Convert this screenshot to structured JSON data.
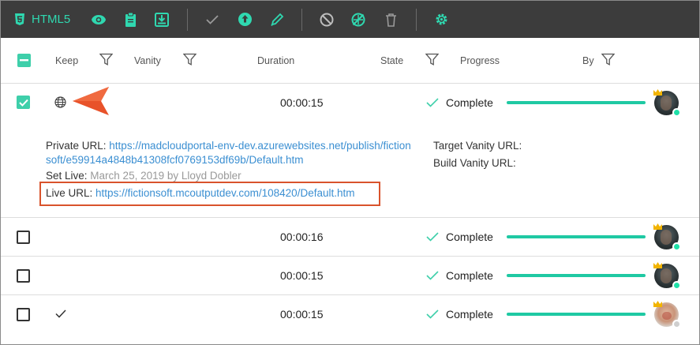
{
  "toolbar": {
    "html5_label": "HTML5",
    "brand_color": "#2fd8b0"
  },
  "header": {
    "keep": "Keep",
    "vanity": "Vanity",
    "duration": "Duration",
    "state": "State",
    "progress": "Progress",
    "by": "By"
  },
  "rows": [
    {
      "selected": true,
      "keep_icon": "globe-icon",
      "duration": "00:00:15",
      "status": "Complete",
      "progress": 1.0,
      "presence": "online"
    },
    {
      "selected": false,
      "keep_icon": "",
      "duration": "00:00:16",
      "status": "Complete",
      "progress": 1.0,
      "presence": "online"
    },
    {
      "selected": false,
      "keep_icon": "",
      "duration": "00:00:15",
      "status": "Complete",
      "progress": 1.0,
      "presence": "online"
    },
    {
      "selected": false,
      "keep_icon": "check-icon",
      "duration": "00:00:15",
      "status": "Complete",
      "progress": 1.0,
      "presence": "offline"
    }
  ],
  "details": {
    "private_url_label": "Private URL:",
    "private_url_line1": "https://madcloudportal-env-dev.azurewebsites.net/publish/fiction",
    "private_url_line2": "soft/e59914a4848b41308fcf0769153df69b/Default.htm",
    "set_live_label": "Set Live:",
    "set_live_value": "March 25, 2019 by Lloyd Dobler",
    "live_url_label": "Live URL:",
    "live_url_value": "https://fictionsoft.mcoutputdev.com/108420/Default.htm",
    "target_vanity_label": "Target Vanity URL:",
    "build_vanity_label": "Build Vanity URL:"
  },
  "colors": {
    "accent": "#3ecfaa",
    "progress": "#1fc9a3",
    "link": "#3b8fd2",
    "callout": "#e8522a",
    "highlight_box": "#d9532c"
  }
}
